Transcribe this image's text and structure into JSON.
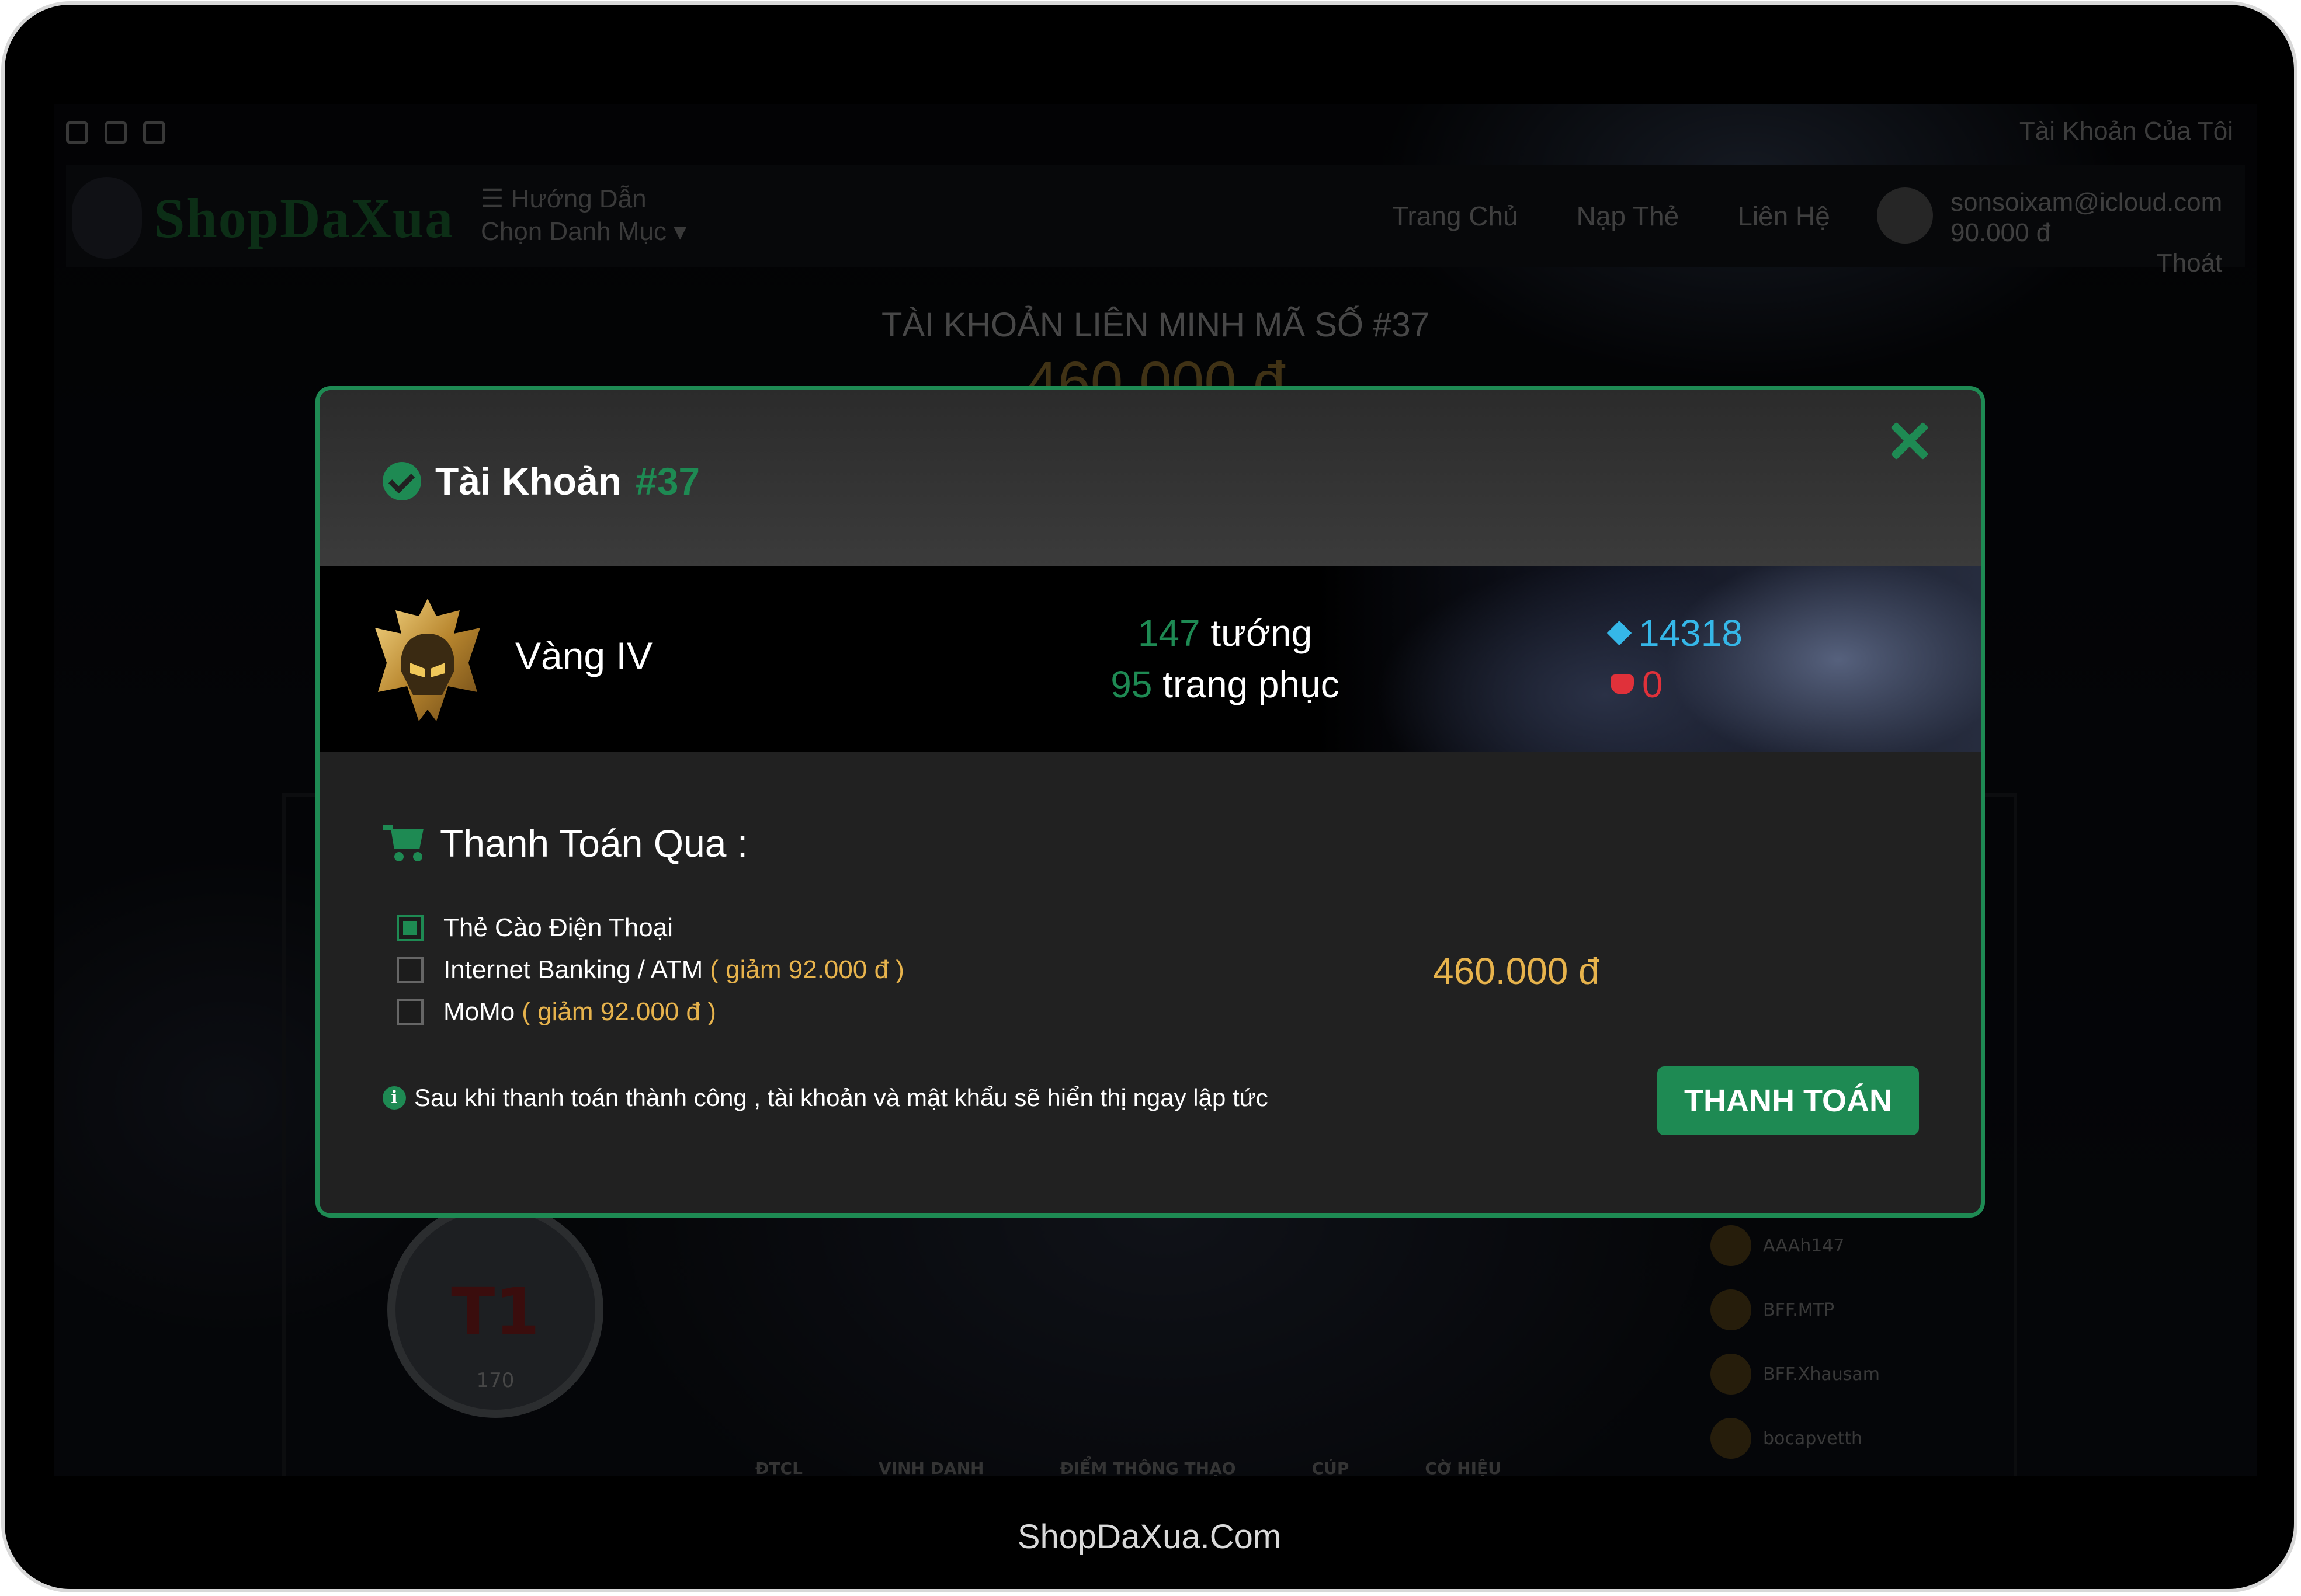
{
  "background": {
    "my_account": "Tài Khoản Của Tôi",
    "logo_text": "ShopDaXua",
    "menu_guide": "☰ Hướng Dẫn",
    "menu_categories": "Chọn Danh Mục ▾",
    "nav": [
      "Trang Chủ",
      "Nạp Thẻ",
      "Liên Hệ"
    ],
    "user_email": "sonsoixam@icloud.com",
    "user_balance": "90.000 đ",
    "logout": "Thoát",
    "page_heading": "TÀI KHOẢN LIÊN MINH MÃ SỐ #37",
    "page_price": "460.000 đ",
    "emblem_text": "T1",
    "emblem_level": "170",
    "side_list": [
      "AAAh147",
      "BFF.MTP",
      "BFF.Xhausam",
      "bocapvetth"
    ],
    "bottom_tabs": [
      "ĐTCL",
      "VINH DANH",
      "ĐIỂM THÔNG THẠO",
      "CÚP",
      "CỜ HIỆU"
    ]
  },
  "modal": {
    "title_label": "Tài Khoản",
    "title_code": "#37",
    "rank": "Vàng IV",
    "champions_count": "147",
    "champions_label": "tướng",
    "skins_count": "95",
    "skins_label": "trang phục",
    "blue_essence": "14318",
    "riot_points": "0",
    "payment_title": "Thanh Toán Qua :",
    "options": [
      {
        "label": "Thẻ Cào Điện Thoại",
        "discount": "",
        "checked": true
      },
      {
        "label": "Internet Banking / ATM",
        "discount": "( giảm 92.000 đ )",
        "checked": false
      },
      {
        "label": "MoMo",
        "discount": "( giảm 92.000 đ )",
        "checked": false
      }
    ],
    "price": "460.000 đ",
    "notice": "Sau khi thanh toán thành công , tài khoản và mật khẩu sẽ hiển thị ngay lập tức",
    "pay_button": "THANH TOÁN"
  },
  "footer": "ShopDaXua.Com",
  "colors": {
    "accent": "#1e8a53",
    "gold": "#e7b34c",
    "blue_essence": "#35b7e8",
    "riot_points": "#e0313a"
  }
}
